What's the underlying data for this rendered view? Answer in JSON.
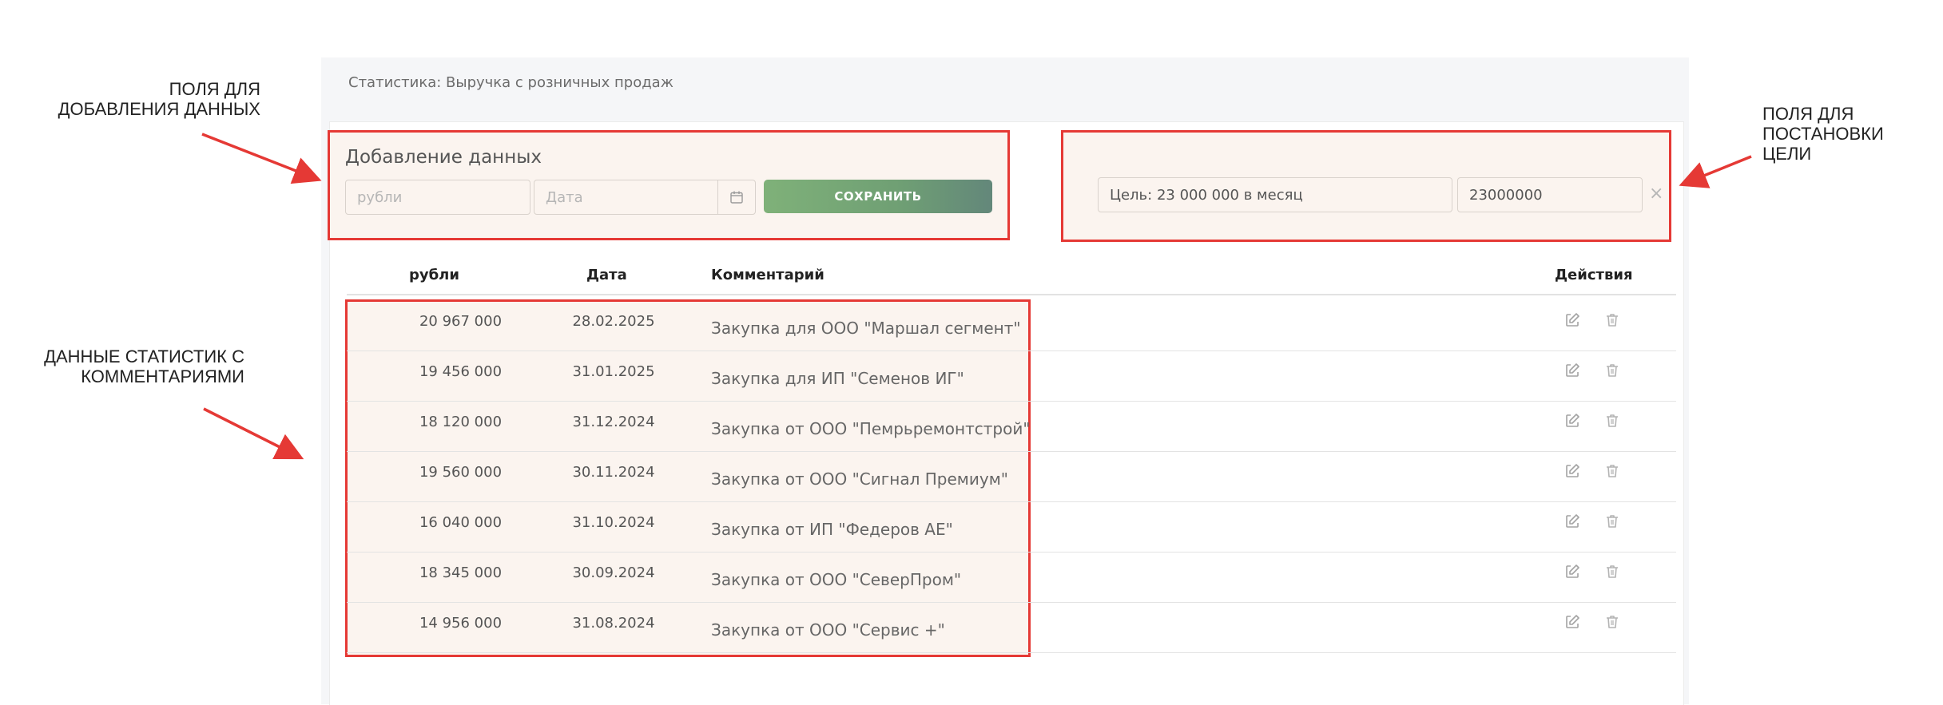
{
  "breadcrumb": "Статистика: Выручка с розничных продаж",
  "add_form": {
    "title": "Добавление данных",
    "amount_placeholder": "рубли",
    "date_placeholder": "Дата",
    "save_label": "СОХРАНИТЬ"
  },
  "goal_form": {
    "label_value": "Цель: 23 000 000 в месяц",
    "amount_value": "23000000",
    "close_glyph": "×"
  },
  "table": {
    "columns": [
      "рубли",
      "Дата",
      "Комментарий",
      "Действия"
    ],
    "rows": [
      {
        "amount": "20 967 000",
        "date": "28.02.2025",
        "comment": "Закупка для ООО \"Маршал сегмент\""
      },
      {
        "amount": "19 456 000",
        "date": "31.01.2025",
        "comment": "Закупка для ИП \"Семенов ИГ\""
      },
      {
        "amount": "18 120 000",
        "date": "31.12.2024",
        "comment": "Закупка от ООО \"Пемрьремонтстрой\""
      },
      {
        "amount": "19 560 000",
        "date": "30.11.2024",
        "comment": "Закупка от ООО \"Сигнал Премиум\""
      },
      {
        "amount": "16 040 000",
        "date": "31.10.2024",
        "comment": "Закупка от ИП \"Федеров АЕ\""
      },
      {
        "amount": "18 345 000",
        "date": "30.09.2024",
        "comment": "Закупка от ООО \"СеверПром\""
      },
      {
        "amount": "14 956 000",
        "date": "31.08.2024",
        "comment": "Закупка от ООО \"Сервис +\""
      }
    ]
  },
  "annotations": {
    "add_fields": [
      "ПОЛЯ ДЛЯ",
      "ДОБАВЛЕНИЯ ДАННЫХ"
    ],
    "stats_data": [
      "ДАННЫЕ СТАТИСТИК С",
      "КОММЕНТАРИЯМИ"
    ],
    "goal_fields": [
      "ПОЛЯ ДЛЯ",
      "ПОСТАНОВКИ",
      "ЦЕЛИ"
    ]
  },
  "icons": {
    "calendar": "calendar-icon",
    "edit": "edit-icon",
    "delete": "trash-icon",
    "close": "close-icon"
  },
  "colors": {
    "highlight_border": "#e53935",
    "highlight_fill": "#fbf4ef",
    "save_button": "#6f9f74",
    "arrow": "#e53935"
  }
}
